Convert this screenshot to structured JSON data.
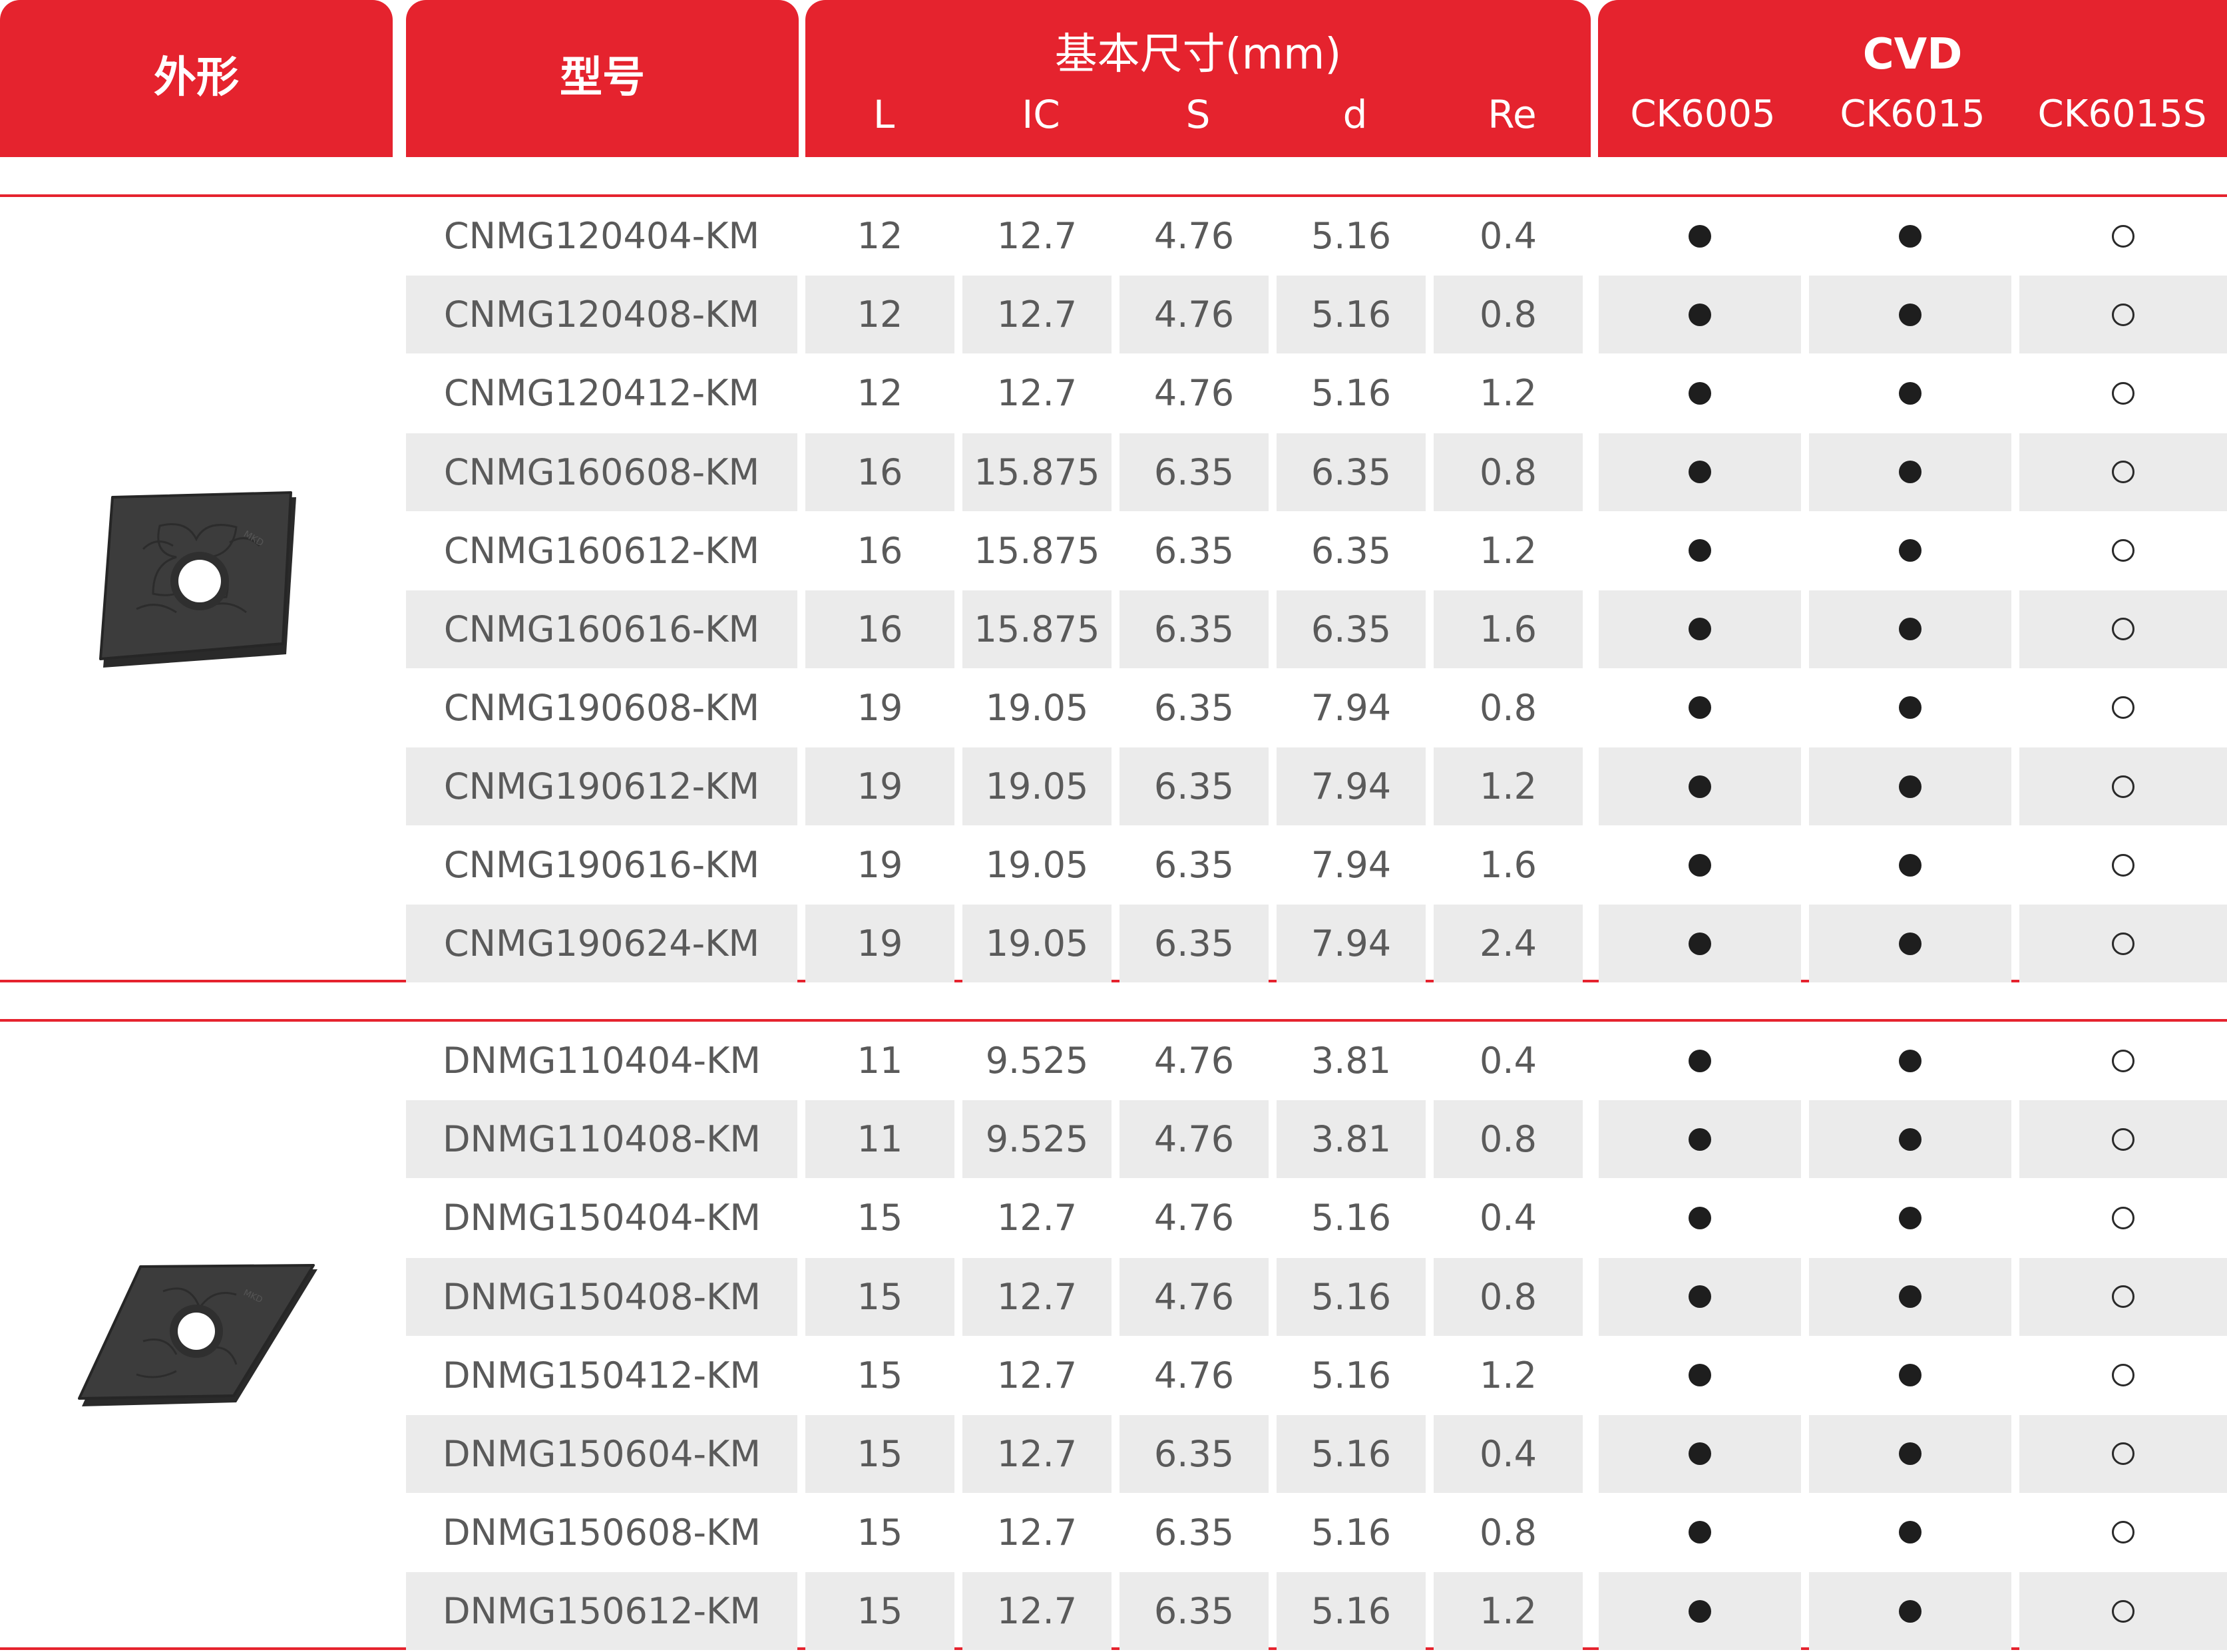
{
  "header": {
    "shape": "外形",
    "model": "型号",
    "dimensions": "基本尺寸(mm)",
    "dim_cols": [
      "L",
      "IC",
      "S",
      "d",
      "Re"
    ],
    "cvd": "CVD",
    "grade_cols": [
      "CK6005",
      "CK6015",
      "CK6015S"
    ]
  },
  "groups": [
    {
      "insert": "cnmg-insert-image",
      "rows": [
        {
          "model": "CNMG120404-KM",
          "L": "12",
          "IC": "12.7",
          "S": "4.76",
          "d": "5.16",
          "Re": "0.4",
          "grades": [
            "filled",
            "filled",
            "open"
          ]
        },
        {
          "model": "CNMG120408-KM",
          "L": "12",
          "IC": "12.7",
          "S": "4.76",
          "d": "5.16",
          "Re": "0.8",
          "grades": [
            "filled",
            "filled",
            "open"
          ]
        },
        {
          "model": "CNMG120412-KM",
          "L": "12",
          "IC": "12.7",
          "S": "4.76",
          "d": "5.16",
          "Re": "1.2",
          "grades": [
            "filled",
            "filled",
            "open"
          ]
        },
        {
          "model": "CNMG160608-KM",
          "L": "16",
          "IC": "15.875",
          "S": "6.35",
          "d": "6.35",
          "Re": "0.8",
          "grades": [
            "filled",
            "filled",
            "open"
          ]
        },
        {
          "model": "CNMG160612-KM",
          "L": "16",
          "IC": "15.875",
          "S": "6.35",
          "d": "6.35",
          "Re": "1.2",
          "grades": [
            "filled",
            "filled",
            "open"
          ]
        },
        {
          "model": "CNMG160616-KM",
          "L": "16",
          "IC": "15.875",
          "S": "6.35",
          "d": "6.35",
          "Re": "1.6",
          "grades": [
            "filled",
            "filled",
            "open"
          ]
        },
        {
          "model": "CNMG190608-KM",
          "L": "19",
          "IC": "19.05",
          "S": "6.35",
          "d": "7.94",
          "Re": "0.8",
          "grades": [
            "filled",
            "filled",
            "open"
          ]
        },
        {
          "model": "CNMG190612-KM",
          "L": "19",
          "IC": "19.05",
          "S": "6.35",
          "d": "7.94",
          "Re": "1.2",
          "grades": [
            "filled",
            "filled",
            "open"
          ]
        },
        {
          "model": "CNMG190616-KM",
          "L": "19",
          "IC": "19.05",
          "S": "6.35",
          "d": "7.94",
          "Re": "1.6",
          "grades": [
            "filled",
            "filled",
            "open"
          ]
        },
        {
          "model": "CNMG190624-KM",
          "L": "19",
          "IC": "19.05",
          "S": "6.35",
          "d": "7.94",
          "Re": "2.4",
          "grades": [
            "filled",
            "filled",
            "open"
          ]
        }
      ]
    },
    {
      "insert": "dnmg-insert-image",
      "rows": [
        {
          "model": "DNMG110404-KM",
          "L": "11",
          "IC": "9.525",
          "S": "4.76",
          "d": "3.81",
          "Re": "0.4",
          "grades": [
            "filled",
            "filled",
            "open"
          ]
        },
        {
          "model": "DNMG110408-KM",
          "L": "11",
          "IC": "9.525",
          "S": "4.76",
          "d": "3.81",
          "Re": "0.8",
          "grades": [
            "filled",
            "filled",
            "open"
          ]
        },
        {
          "model": "DNMG150404-KM",
          "L": "15",
          "IC": "12.7",
          "S": "4.76",
          "d": "5.16",
          "Re": "0.4",
          "grades": [
            "filled",
            "filled",
            "open"
          ]
        },
        {
          "model": "DNMG150408-KM",
          "L": "15",
          "IC": "12.7",
          "S": "4.76",
          "d": "5.16",
          "Re": "0.8",
          "grades": [
            "filled",
            "filled",
            "open"
          ]
        },
        {
          "model": "DNMG150412-KM",
          "L": "15",
          "IC": "12.7",
          "S": "4.76",
          "d": "5.16",
          "Re": "1.2",
          "grades": [
            "filled",
            "filled",
            "open"
          ]
        },
        {
          "model": "DNMG150604-KM",
          "L": "15",
          "IC": "12.7",
          "S": "6.35",
          "d": "5.16",
          "Re": "0.4",
          "grades": [
            "filled",
            "filled",
            "open"
          ]
        },
        {
          "model": "DNMG150608-KM",
          "L": "15",
          "IC": "12.7",
          "S": "6.35",
          "d": "5.16",
          "Re": "0.8",
          "grades": [
            "filled",
            "filled",
            "open"
          ]
        },
        {
          "model": "DNMG150612-KM",
          "L": "15",
          "IC": "12.7",
          "S": "6.35",
          "d": "5.16",
          "Re": "1.2",
          "grades": [
            "filled",
            "filled",
            "open"
          ]
        }
      ]
    }
  ],
  "colors": {
    "header_red": "#e5232e",
    "row_shade": "#ebebeb",
    "text_gray": "#5a5a5a",
    "insert_dark": "#3a3a3a"
  }
}
